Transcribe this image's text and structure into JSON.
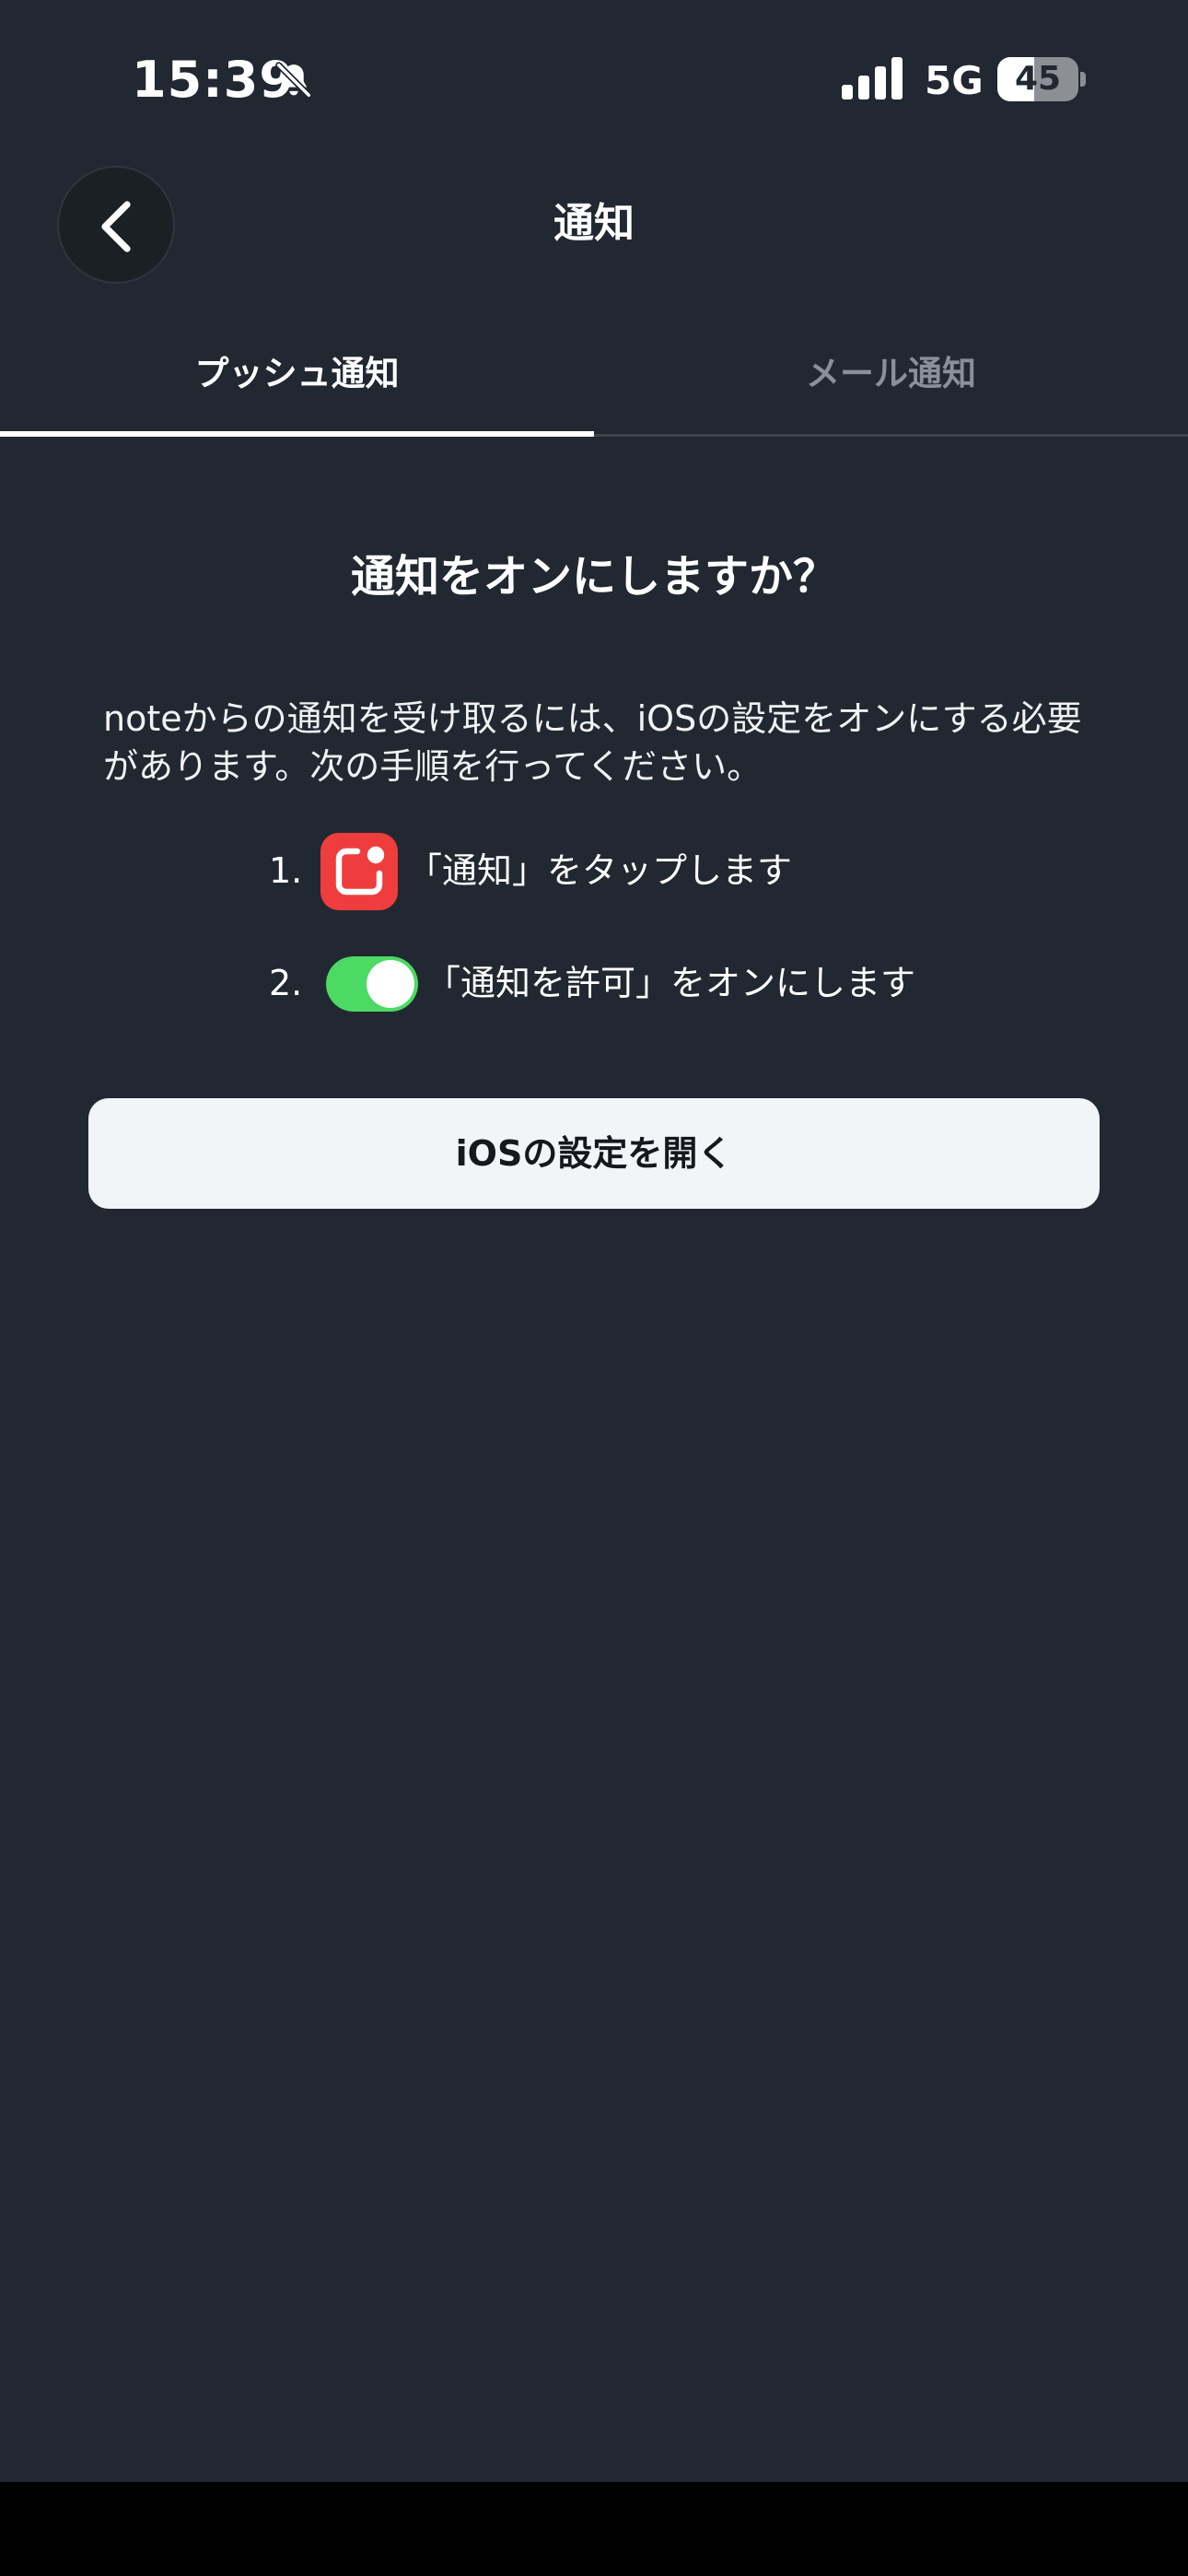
{
  "status_bar": {
    "time": "15:39",
    "network": "5G",
    "battery_level": "45",
    "battery_fraction": 0.45,
    "icons": [
      "bell-slash-icon",
      "cellular-signal-icon",
      "battery-icon"
    ]
  },
  "header": {
    "title": "通知",
    "back_icon": "chevron-left-icon"
  },
  "tabs": [
    {
      "label": "プッシュ通知",
      "active": true
    },
    {
      "label": "メール通知",
      "active": false
    }
  ],
  "content": {
    "heading": "通知をオンにしますか？",
    "description": "noteからの通知を受け取るには、iOSの設定をオンにする必要があります。次の手順を行ってください。",
    "steps": [
      {
        "number": "1.",
        "icon": "notifications-app-icon",
        "text": "「通知」をタップします"
      },
      {
        "number": "2.",
        "icon": "toggle-switch-icon",
        "text": "「通知を許可」をオンにします"
      }
    ],
    "button_label": "iOSの設定を開く"
  },
  "colors": {
    "background": "#222831",
    "notification_icon": "#ef3d3d",
    "toggle_on": "#4cd964",
    "button_background": "#f2f5f8",
    "inactive_tab": "#8a9099"
  }
}
